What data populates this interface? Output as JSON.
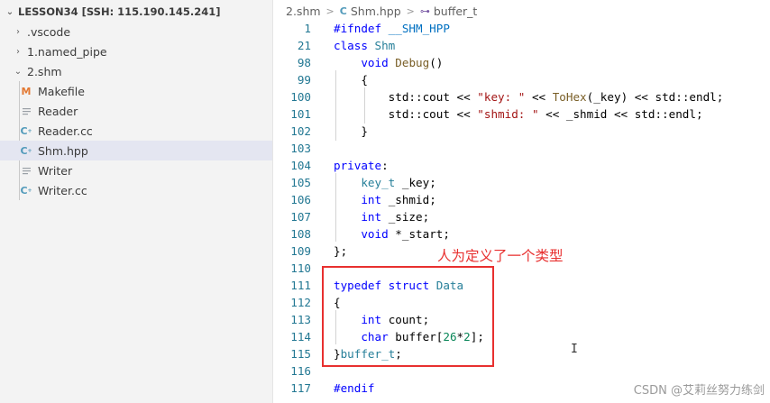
{
  "explorer": {
    "root_label": "LESSON34 [SSH: 115.190.145.241]",
    "items": [
      {
        "label": ".vscode",
        "type": "folder",
        "expanded": false
      },
      {
        "label": "1.named_pipe",
        "type": "folder",
        "expanded": false
      },
      {
        "label": "2.shm",
        "type": "folder",
        "expanded": true
      },
      {
        "label": "Makefile",
        "type": "file",
        "icon": "makefile-icon"
      },
      {
        "label": "Reader",
        "type": "file",
        "icon": "file-icon"
      },
      {
        "label": "Reader.cc",
        "type": "file",
        "icon": "cpp-icon"
      },
      {
        "label": "Shm.hpp",
        "type": "file",
        "icon": "cpp-icon",
        "selected": true
      },
      {
        "label": "Writer",
        "type": "file",
        "icon": "file-icon"
      },
      {
        "label": "Writer.cc",
        "type": "file",
        "icon": "cpp-icon"
      }
    ],
    "icon_glyphs": {
      "makefile": "M",
      "cpp": "C",
      "chevron_right": "›",
      "chevron_down": "⌄"
    }
  },
  "breadcrumb": {
    "items": [
      "2.shm",
      "Shm.hpp",
      "buffer_t"
    ],
    "separator": ">"
  },
  "code": {
    "lines": [
      {
        "num": "1",
        "text": "#ifndef __SHM_HPP"
      },
      {
        "num": "21",
        "text": "class Shm"
      },
      {
        "num": "98",
        "text": "    void Debug()"
      },
      {
        "num": "99",
        "text": "    {"
      },
      {
        "num": "100",
        "text": "        std::cout << \"key: \" << ToHex(_key) << std::endl;"
      },
      {
        "num": "101",
        "text": "        std::cout << \"shmid: \" << _shmid << std::endl;"
      },
      {
        "num": "102",
        "text": "    }"
      },
      {
        "num": "103",
        "text": ""
      },
      {
        "num": "104",
        "text": "private:"
      },
      {
        "num": "105",
        "text": "    key_t _key;"
      },
      {
        "num": "106",
        "text": "    int _shmid;"
      },
      {
        "num": "107",
        "text": "    int _size;"
      },
      {
        "num": "108",
        "text": "    void *_start;"
      },
      {
        "num": "109",
        "text": "};"
      },
      {
        "num": "110",
        "text": ""
      },
      {
        "num": "111",
        "text": "typedef struct Data"
      },
      {
        "num": "112",
        "text": "{"
      },
      {
        "num": "113",
        "text": "    int count;"
      },
      {
        "num": "114",
        "text": "    char buffer[26*2];"
      },
      {
        "num": "115",
        "text": "}buffer_t;"
      },
      {
        "num": "116",
        "text": ""
      },
      {
        "num": "117",
        "text": "#endif"
      }
    ]
  },
  "annotation": {
    "text": "人为定义了一个类型",
    "color": "#e8302f"
  },
  "watermark": "CSDN @艾莉丝努力练剑",
  "colors": {
    "keyword": "#0000ff",
    "type": "#267f99",
    "string": "#a31515",
    "line_number": "#237893",
    "selection_bg": "#e4e6f1",
    "annotation": "#e8302f"
  }
}
